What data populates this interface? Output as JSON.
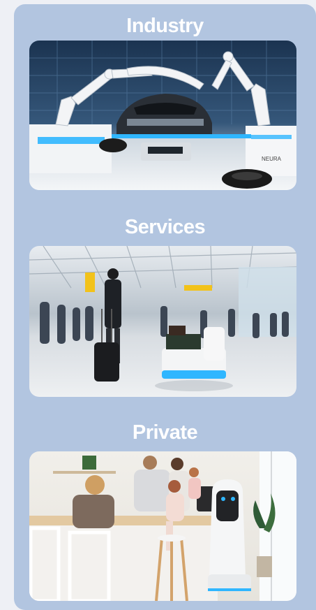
{
  "sections": [
    {
      "title": "Industry"
    },
    {
      "title": "Services"
    },
    {
      "title": "Private"
    }
  ],
  "images": {
    "industry": {
      "subject": "robot-arms-assembling-car",
      "brand_text": "NEURA"
    },
    "services": {
      "subject": "service-robot-in-airport-terminal"
    },
    "private": {
      "subject": "home-robot-in-kitchen-with-family"
    }
  },
  "colors": {
    "panel": "#b2c5e0",
    "page": "#eef0f5",
    "title": "#ffffff",
    "accent_glow": "#2fb6ff"
  }
}
